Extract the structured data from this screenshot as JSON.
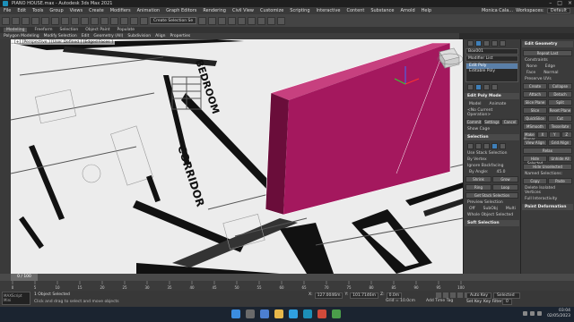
{
  "titlebar": {
    "title": "PIANO HOUSE.max - Autodesk 3ds Max 2021"
  },
  "menu": [
    "File",
    "Edit",
    "Tools",
    "Group",
    "Views",
    "Create",
    "Modifiers",
    "Animation",
    "Graph Editors",
    "Rendering",
    "Civil View",
    "Customize",
    "Scripting",
    "Interactive",
    "Content",
    "Substance",
    "Arnold",
    "Help"
  ],
  "workspace": {
    "user": "Monica Cala...",
    "label": "Workspaces:",
    "value": "Default"
  },
  "toolbar": {
    "selection_set": "Create Selection Se"
  },
  "ribbon": {
    "tabs": [
      "Modeling",
      "Freeform",
      "Selection",
      "Object Paint",
      "Populate"
    ],
    "active": "Modeling",
    "groups": [
      "Polygon Modeling",
      "Modify Selection",
      "Edit",
      "Geometry (All)",
      "Subdivision",
      "Align",
      "Properties"
    ]
  },
  "viewport": {
    "label": "[+] [Perspective ] [User Defined ] [Edged Faces ]",
    "text_bedroom": "BEDROOM",
    "text_corridor": "CORRIDOR"
  },
  "modifier_panel": {
    "object_name": "Box001",
    "modifier_list": "Modifier List",
    "stack": [
      "Edit Poly",
      "Editable Poly"
    ],
    "mode_title": "Edit Poly Mode",
    "model_label": "Model",
    "animate_label": "Animate",
    "current_op": "<No Current Operation>",
    "commit": "Commit",
    "settings": "Settings",
    "cancel": "Cancel",
    "show_cage": "Show Cage",
    "selection_title": "Selection",
    "use_stack": "Use Stack Selection",
    "by_vertex": "By Vertex",
    "ignore_backfacing": "Ignore Backfacing",
    "by_angle": "By Angle:",
    "angle": "45.0",
    "shrink": "Shrink",
    "grow": "Grow",
    "ring": "Ring",
    "loop": "Loop",
    "get_stack": "Get Stack Selection",
    "preview_title": "Preview Selection",
    "off": "Off",
    "subobj": "SubObj",
    "multi": "Multi",
    "selected": "Whole Object Selected",
    "soft_title": "Soft Selection"
  },
  "edit_geometry": {
    "title": "Edit Geometry",
    "repeat": "Repeat Last",
    "constraints": "Constraints",
    "none": "None",
    "edge": "Edge",
    "face": "Face",
    "normal": "Normal",
    "preserve": "Preserve UVs",
    "create": "Create",
    "collapse": "Collapse",
    "attach": "Attach",
    "detach": "Detach",
    "slice_plane": "Slice Plane",
    "split": "Split",
    "slice": "Slice",
    "reset_plane": "Reset Plane",
    "quickslice": "QuickSlice",
    "cut": "Cut",
    "msmooth": "MSmooth",
    "tessellate": "Tessellate",
    "make_planar": "Make Planar",
    "x": "X",
    "y": "Y",
    "z": "Z",
    "view_align": "View Align",
    "grid_align": "Grid Align",
    "relax": "Relax",
    "hide_sel": "Hide Selected",
    "unhide": "Unhide All",
    "hide_unsel": "Hide Unselected",
    "named_sel": "Named Selections:",
    "copy": "Copy",
    "paste": "Paste",
    "delete_iso": "Delete Isolated Vertices",
    "full_interactivity": "Full Interactivity",
    "paint_title": "Paint Deformation"
  },
  "timeline": {
    "frame": "0 / 100"
  },
  "ticks": [
    "0",
    "5",
    "10",
    "15",
    "20",
    "25",
    "30",
    "35",
    "40",
    "45",
    "50",
    "55",
    "60",
    "65",
    "70",
    "75",
    "80",
    "85",
    "90",
    "95",
    "100"
  ],
  "status": {
    "maxscript": "MAXScript Mini",
    "line1": "1 Object Selected",
    "line2": "Click and drag to select and move objects",
    "x_label": "X:",
    "x": "127.0046m",
    "y_label": "Y:",
    "y": "101.7146m",
    "z_label": "Z:",
    "z": "0.0m",
    "grid": "Grid = 10.0cm",
    "add_tag": "Add Time Tag",
    "auto_key": "Auto Key",
    "selected": "Selected",
    "set_key": "Set Key",
    "key_filters": "Key Filters...",
    "frame_field": "0"
  },
  "tray": {
    "time": "03:04",
    "date": "02/05/2023"
  },
  "colors": {
    "wall": "#a4185e",
    "accent": "#3f7fb8"
  }
}
